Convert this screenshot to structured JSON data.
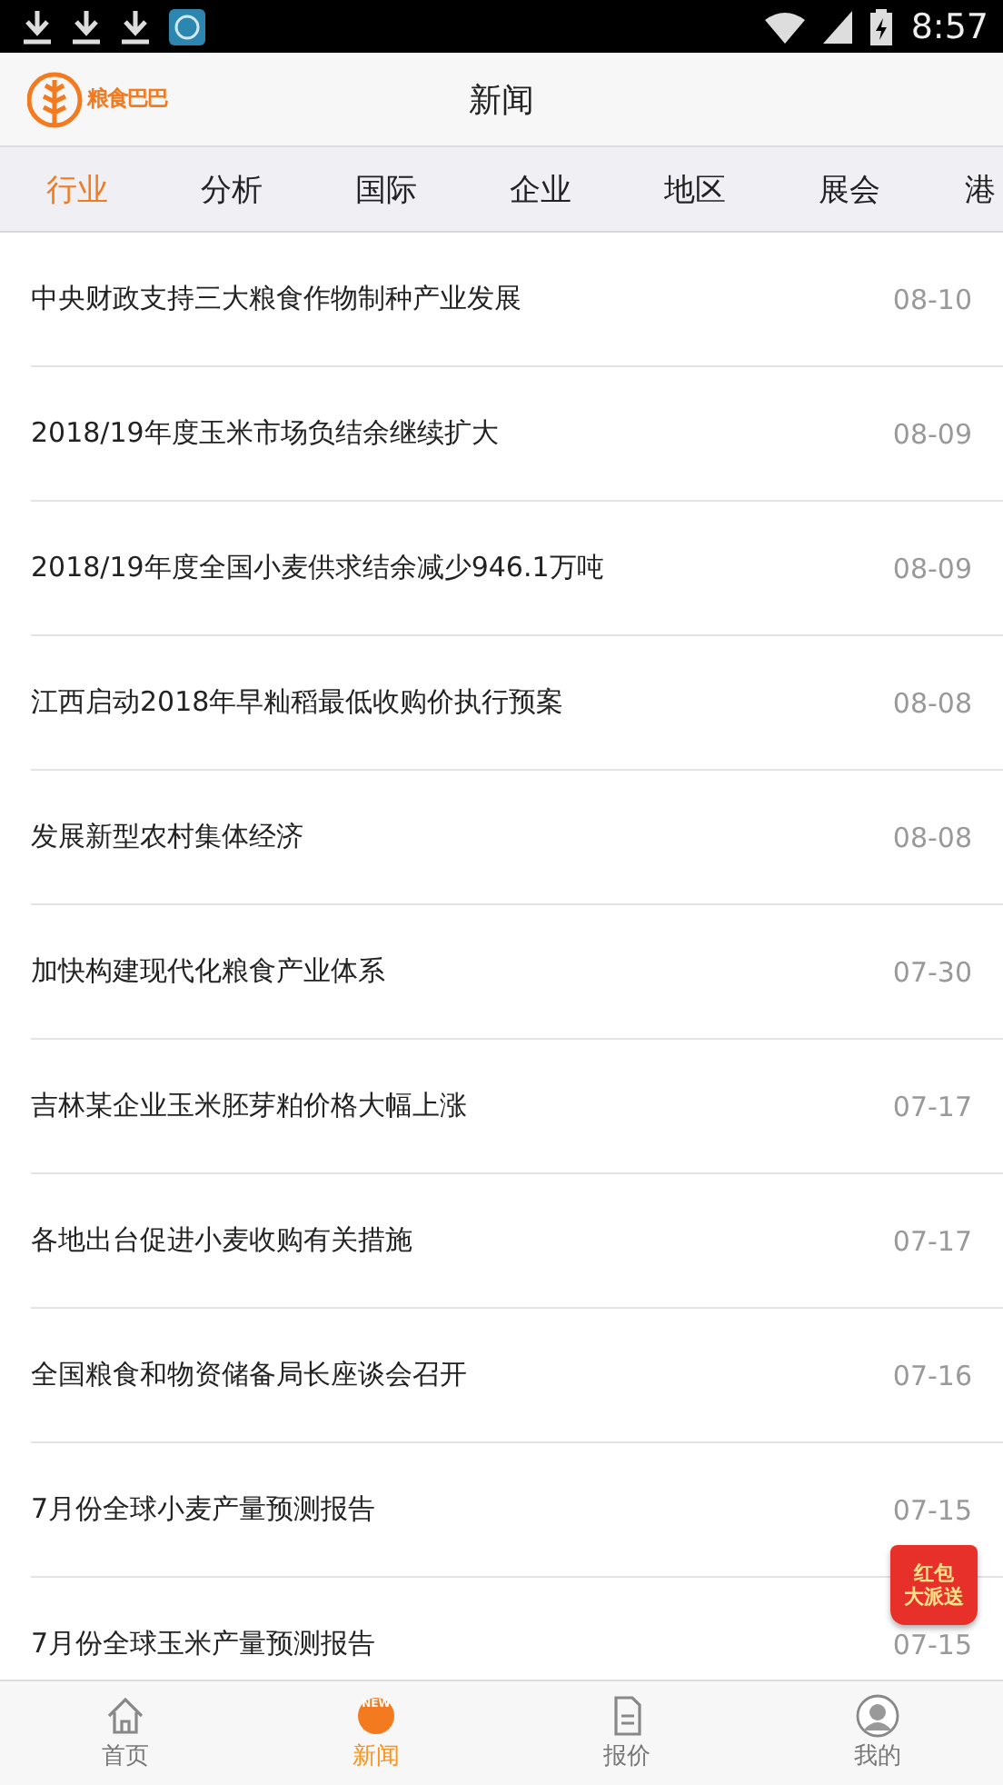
{
  "status_bar": {
    "time": "8:57"
  },
  "header": {
    "logo_text": "粮食巴巴",
    "title": "新闻"
  },
  "tabs": [
    {
      "label": "行业",
      "selected": true
    },
    {
      "label": "分析",
      "selected": false
    },
    {
      "label": "国际",
      "selected": false
    },
    {
      "label": "企业",
      "selected": false
    },
    {
      "label": "地区",
      "selected": false
    },
    {
      "label": "展会",
      "selected": false
    },
    {
      "label": "港",
      "selected": false
    }
  ],
  "news": [
    {
      "title": "中央财政支持三大粮食作物制种产业发展",
      "date": "08-10"
    },
    {
      "title": "2018/19年度玉米市场负结余继续扩大",
      "date": "08-09"
    },
    {
      "title": "2018/19年度全国小麦供求结余减少946.1万吨",
      "date": "08-09"
    },
    {
      "title": "江西启动2018年早籼稻最低收购价执行预案",
      "date": "08-08"
    },
    {
      "title": "发展新型农村集体经济",
      "date": "08-08"
    },
    {
      "title": "加快构建现代化粮食产业体系",
      "date": "07-30"
    },
    {
      "title": "吉林某企业玉米胚芽粕价格大幅上涨",
      "date": "07-17"
    },
    {
      "title": "各地出台促进小麦收购有关措施",
      "date": "07-17"
    },
    {
      "title": "全国粮食和物资储备局长座谈会召开",
      "date": "07-16"
    },
    {
      "title": "7月份全球小麦产量预测报告",
      "date": "07-15"
    },
    {
      "title": "7月份全球玉米产量预测报告",
      "date": "07-15"
    }
  ],
  "promo_badge": {
    "line_1": "红包",
    "line_2": "大派送"
  },
  "bottom_nav": [
    {
      "label": "首页",
      "kind": "home",
      "selected": false
    },
    {
      "label": "新闻",
      "kind": "news",
      "badge": "NEW",
      "selected": true
    },
    {
      "label": "报价",
      "kind": "quote",
      "selected": false
    },
    {
      "label": "我的",
      "kind": "profile",
      "selected": false
    }
  ]
}
